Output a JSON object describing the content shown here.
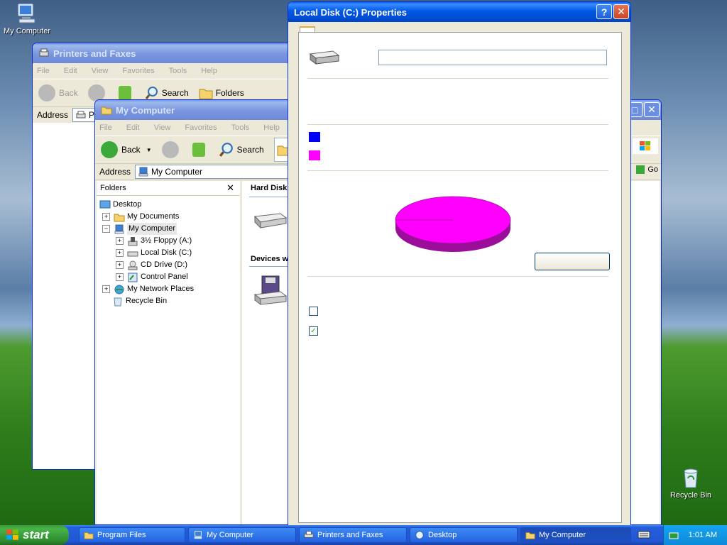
{
  "desktop": {
    "icons": [
      {
        "label": "My Computer",
        "icon": "my-computer-icon"
      },
      {
        "label": "Recycle Bin",
        "icon": "recycle-bin-icon"
      }
    ]
  },
  "printers_window": {
    "title": "Printers and Faxes",
    "menu": [
      "File",
      "Edit",
      "View",
      "Favorites",
      "Tools",
      "Help"
    ],
    "toolbar": {
      "back": "Back",
      "search": "Search",
      "folders": "Folders"
    },
    "address_label": "Address",
    "address_value": "Pri"
  },
  "mycomputer_window": {
    "title": "My Computer",
    "menu": [
      "File",
      "Edit",
      "View",
      "Favorites",
      "Tools",
      "Help"
    ],
    "toolbar": {
      "back": "Back",
      "search": "Search"
    },
    "address_label": "Address",
    "address_value": "My Computer",
    "go_label": "Go",
    "folders_pane": {
      "title": "Folders",
      "close": "✕",
      "tree": [
        {
          "label": "Desktop",
          "level": 0,
          "expander": ""
        },
        {
          "label": "My Documents",
          "level": 1,
          "expander": "+"
        },
        {
          "label": "My Computer",
          "level": 1,
          "expander": "−"
        },
        {
          "label": "3½ Floppy (A:)",
          "level": 2,
          "expander": "+"
        },
        {
          "label": "Local Disk (C:)",
          "level": 2,
          "expander": "+"
        },
        {
          "label": "CD Drive (D:)",
          "level": 2,
          "expander": "+"
        },
        {
          "label": "Control Panel",
          "level": 2,
          "expander": "+"
        },
        {
          "label": "My Network Places",
          "level": 1,
          "expander": "+"
        },
        {
          "label": "Recycle Bin",
          "level": 1,
          "expander": ""
        }
      ]
    },
    "sections": {
      "hard_disk": "Hard Disk",
      "devices": "Devices w"
    }
  },
  "properties_dialog": {
    "title": "Local Disk (C:) Properties",
    "help_button": "?",
    "close_button": "✕",
    "name_field_value": "",
    "used_color": "#0000ff",
    "free_color": "#ff00ff",
    "pie": {
      "used_fraction": 0.0,
      "free_fraction": 1.0
    },
    "cleanup_button_label": "",
    "compress_checked": false,
    "index_checked": true
  },
  "taskbar": {
    "start_label": "start",
    "tasks": [
      {
        "label": "Program Files",
        "icon": "folder-icon",
        "active": false
      },
      {
        "label": "My Computer",
        "icon": "my-computer-icon",
        "active": false
      },
      {
        "label": "Printers and Faxes",
        "icon": "printer-icon",
        "active": false
      },
      {
        "label": "Desktop",
        "icon": "desktop-icon",
        "active": false
      },
      {
        "label": "My Computer",
        "icon": "folder-icon",
        "active": true
      }
    ],
    "clock": "1:01 AM"
  }
}
